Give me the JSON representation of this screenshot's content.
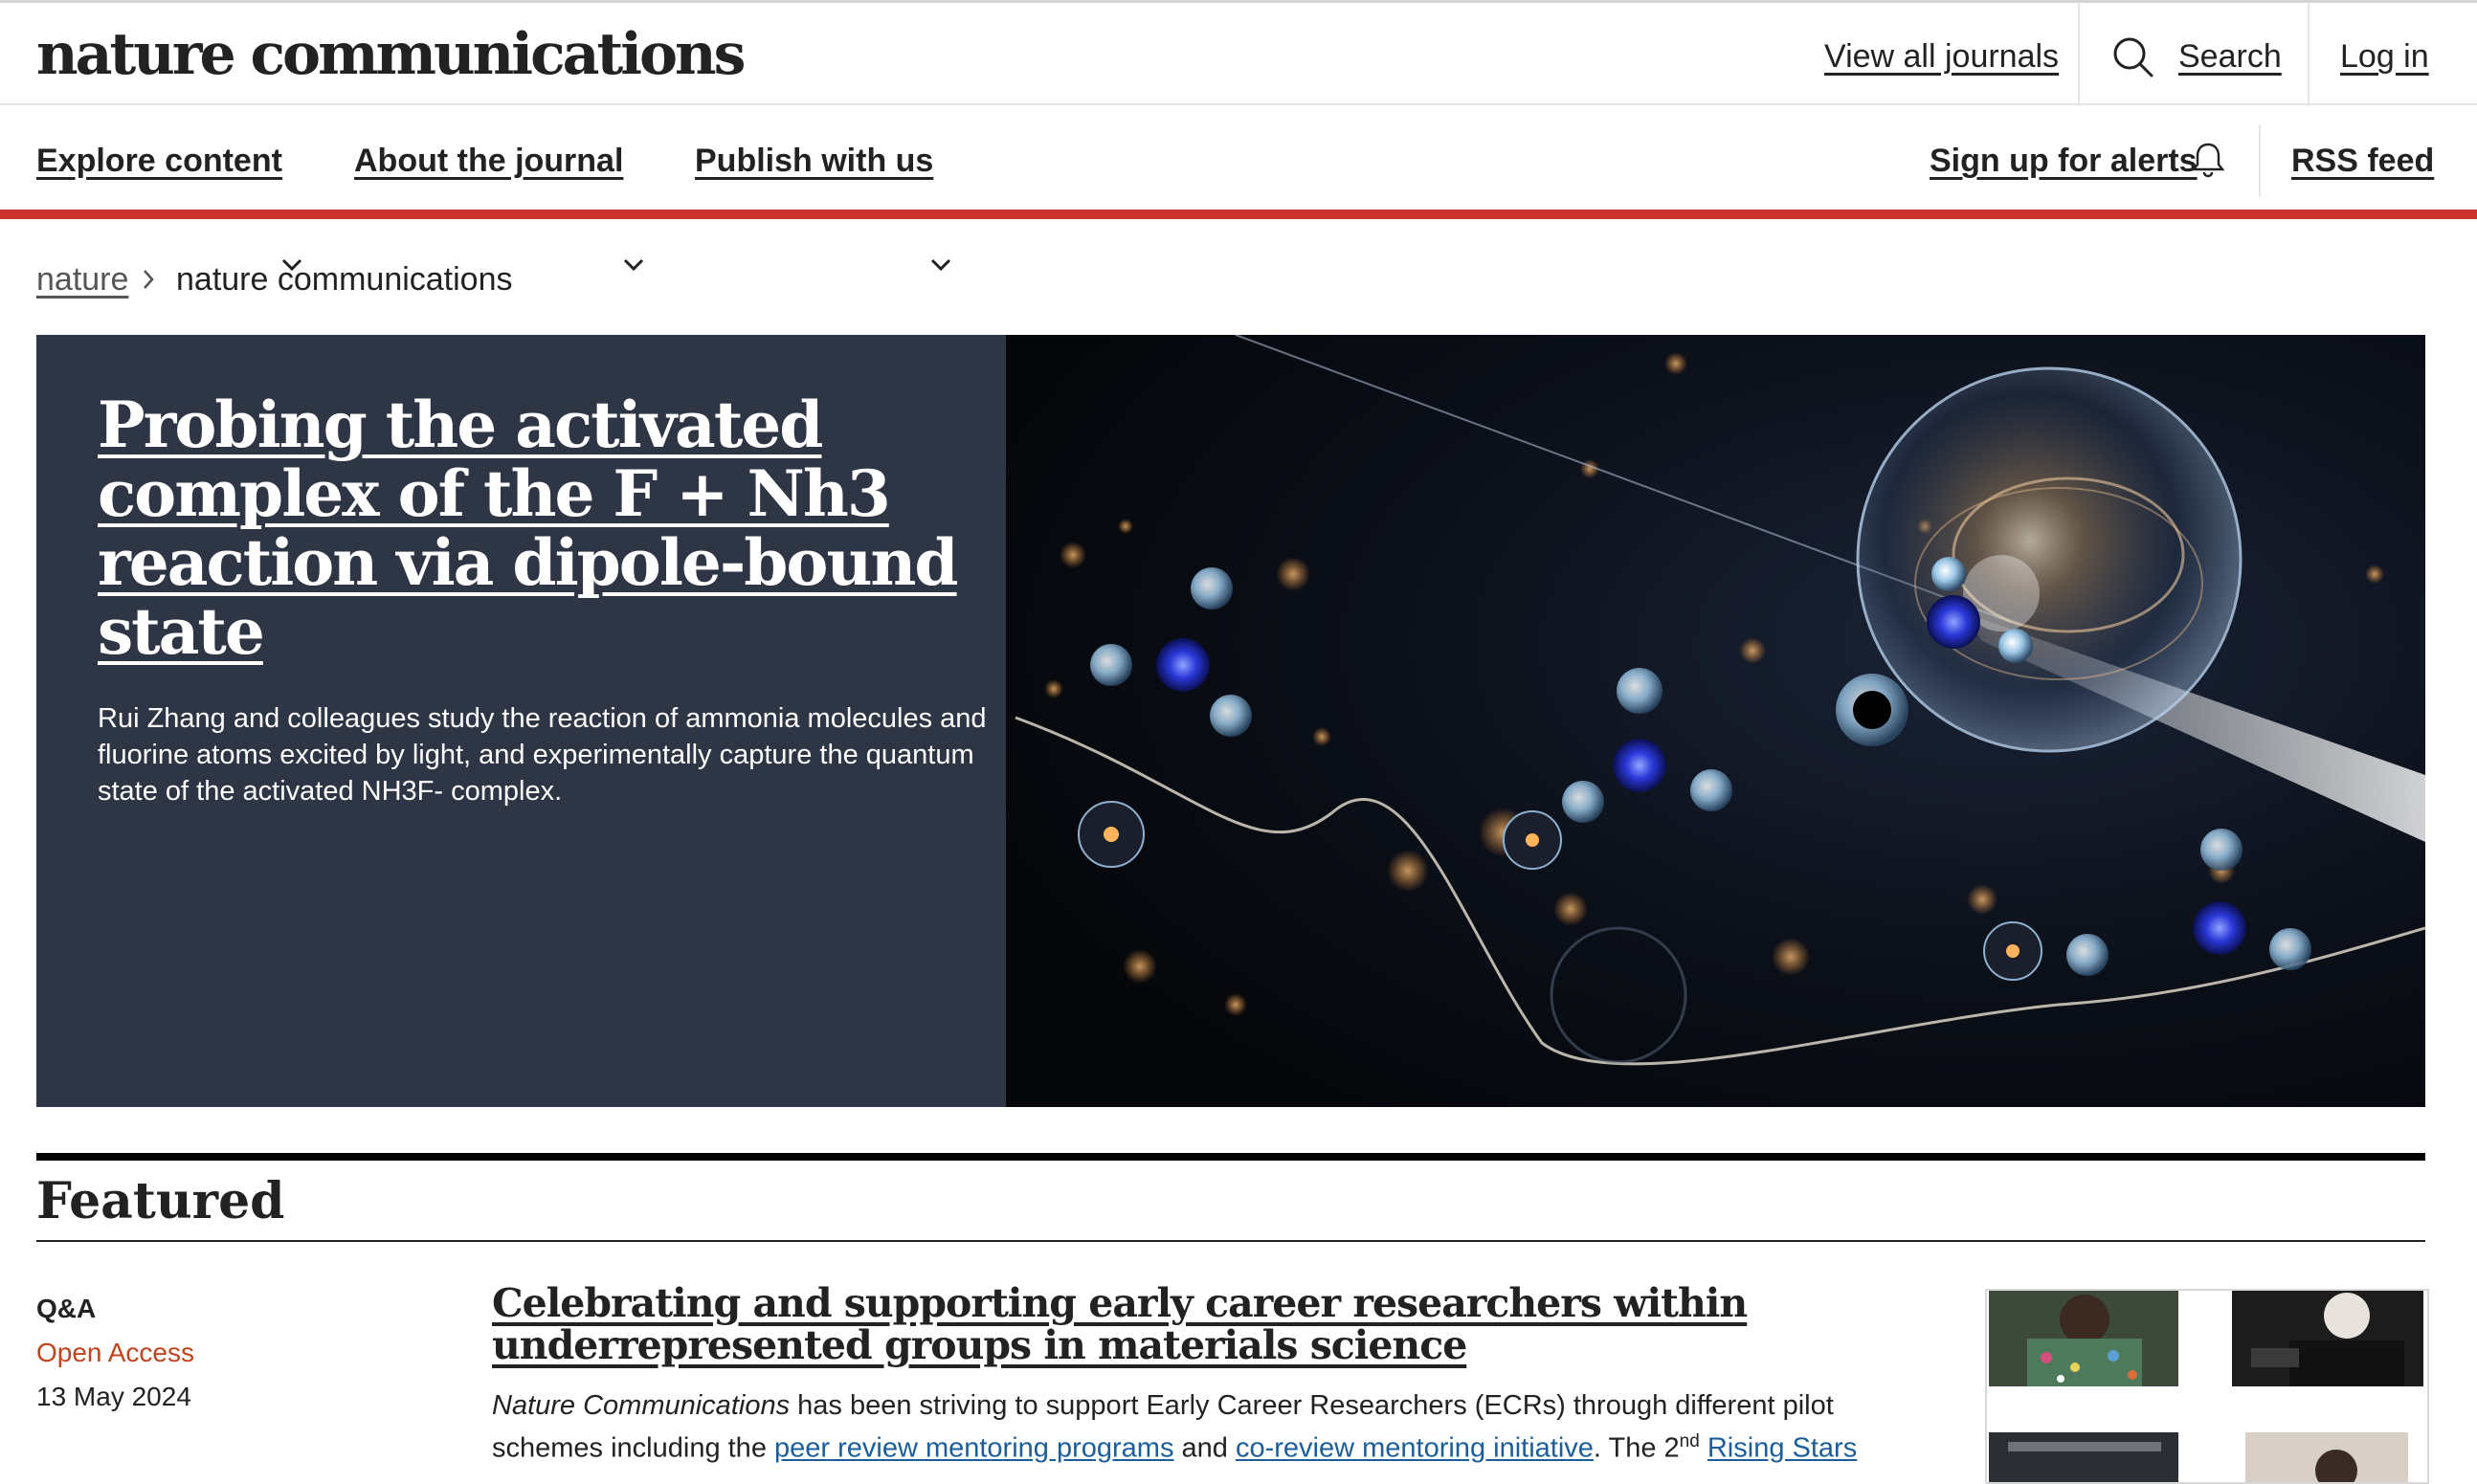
{
  "header": {
    "logo": "nature communications",
    "view_all_journals": "View all journals",
    "search_label": "Search",
    "login_label": "Log in"
  },
  "nav": {
    "explore": "Explore content",
    "about": "About the journal",
    "publish": "Publish with us",
    "alerts": "Sign up for alerts",
    "rss": "RSS feed"
  },
  "breadcrumb": {
    "root": "nature",
    "current": "nature communications"
  },
  "hero": {
    "title": "Probing the activated complex of the F + Nh3 reaction via dipole-bound state",
    "description": "Rui Zhang and colleagues study the reaction of ammonia molecules and fluorine atoms excited by light, and experimentally capture the quantum state of the activated NH3F- complex."
  },
  "featured": {
    "heading": "Featured",
    "article": {
      "type": "Q&A",
      "access": "Open Access",
      "date": "13 May 2024",
      "title": "Celebrating and supporting early career researchers within underrepresented groups in materials science",
      "desc_journal": "Nature Communications",
      "desc_part1": " has been striving to support Early Career Researchers (ECRs) through different pilot schemes including the ",
      "link1": "peer review mentoring programs",
      "desc_and": " and ",
      "link2": "co-review mentoring initiative",
      "desc_part2": ". The 2",
      "desc_sup": "nd",
      "desc_space": " ",
      "link3": "Rising Stars"
    }
  },
  "colors": {
    "accent_red": "#d0352d",
    "hero_bg": "#2e3544",
    "link_blue": "#1b5e9b",
    "open_access": "#c0441f"
  }
}
